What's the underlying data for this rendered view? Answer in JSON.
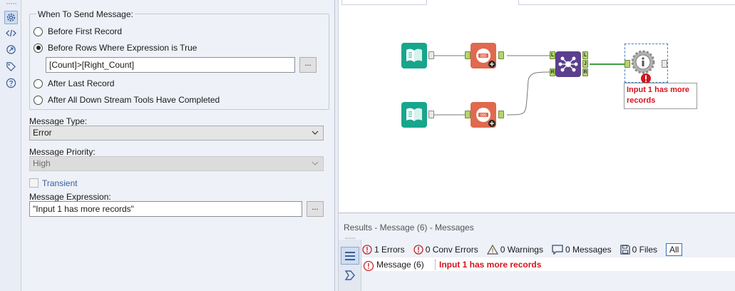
{
  "config": {
    "group_title": "When To Send Message:",
    "options": [
      {
        "label": "Before First Record",
        "checked": false
      },
      {
        "label": "Before Rows Where Expression is True",
        "checked": true
      },
      {
        "label": "After Last Record",
        "checked": false
      },
      {
        "label": "After All Down Stream Tools Have Completed",
        "checked": false
      }
    ],
    "expression_value": "[Count]>[Right_Count]",
    "ellipsis": "...",
    "message_type_label": "Message Type:",
    "message_type_value": "Error",
    "message_priority_label": "Message Priority:",
    "message_priority_value": "High",
    "transient_label": "Transient",
    "message_expression_label": "Message Expression:",
    "message_expression_value": "\"Input 1 has more records\""
  },
  "canvas": {
    "anchors": {
      "left": "L",
      "join": "J",
      "right": "R"
    },
    "bubble_text": "Input 1 has more records"
  },
  "results": {
    "title": "Results - Message (6) - Messages",
    "filters": {
      "errors": "1 Errors",
      "conv_errors": "0 Conv Errors",
      "warnings": "0 Warnings",
      "messages": "0 Messages",
      "files": "0 Files",
      "all": "All"
    },
    "row": {
      "tool": "Message (6)",
      "message": "Input 1 has more records"
    }
  },
  "colors": {
    "input_tool": "#17a68c",
    "count_tool": "#e0694e",
    "join_tool": "#5b3f8e",
    "error_red": "#d4141b",
    "connection_green": "#3b9e43"
  }
}
